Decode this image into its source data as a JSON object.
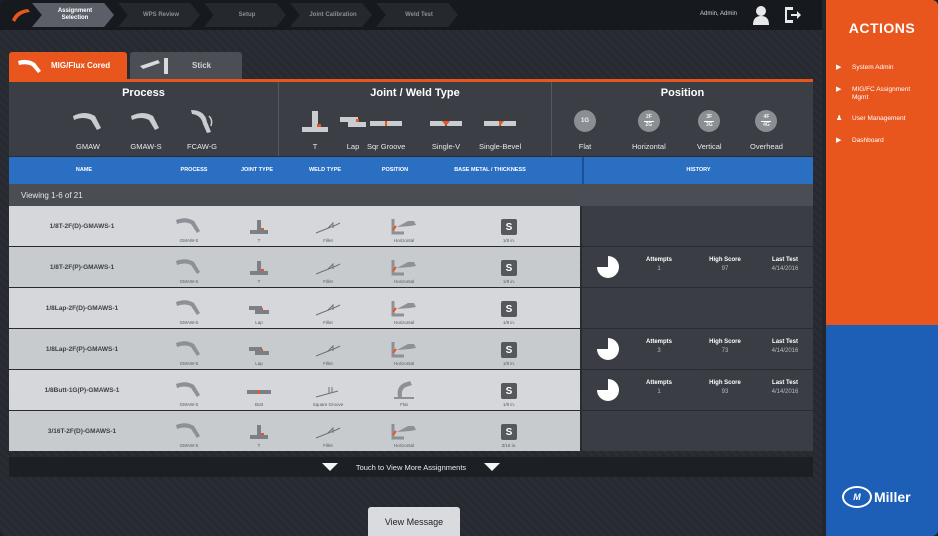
{
  "breadcrumb": [
    {
      "label": "Assignment Selection",
      "active": true
    },
    {
      "label": "WPS Review",
      "active": false
    },
    {
      "label": "Setup",
      "active": false
    },
    {
      "label": "Joint Calibration",
      "active": false
    },
    {
      "label": "Weld Test",
      "active": false
    }
  ],
  "user": {
    "name": "Admin, Admin"
  },
  "tabs": [
    {
      "label": "MIG/Flux Cored",
      "active": true
    },
    {
      "label": "Stick",
      "active": false
    }
  ],
  "filters": {
    "process": {
      "title": "Process",
      "options": [
        "GMAW",
        "GMAW-S",
        "FCAW-G"
      ]
    },
    "joint": {
      "title": "Joint / Weld Type",
      "options": [
        "T",
        "Lap",
        "Sqr Groove",
        "Single-V",
        "Single-Bevel"
      ]
    },
    "position": {
      "title": "Position",
      "options": [
        {
          "label": "Flat",
          "code": "1G"
        },
        {
          "label": "Horizontal",
          "code_top": "2F",
          "code_bottom": "2G"
        },
        {
          "label": "Vertical",
          "code_top": "3F",
          "code_bottom": "3G"
        },
        {
          "label": "Overhead",
          "code_top": "4F",
          "code_bottom": "4G"
        }
      ]
    }
  },
  "table": {
    "headers": {
      "name": "NAME",
      "process": "PROCESS",
      "joint_type": "JOINT TYPE",
      "weld_type": "WELD TYPE",
      "position": "POSITION",
      "base_metal": "BASE METAL / THICKNESS",
      "history": "HISTORY"
    },
    "viewing": "Viewing 1-6 of 21",
    "history_labels": {
      "attempts": "Attempts",
      "high_score": "High Score",
      "last_test": "Last Test"
    },
    "rows": [
      {
        "name": "1/8T-2F(D)-GMAWS-1",
        "process": "GMAW-S",
        "joint": "T",
        "weld": "Fillet",
        "position": "Horizontal",
        "metal": "S",
        "thickness": "1/8 in.",
        "history": null
      },
      {
        "name": "1/8T-2F(P)-GMAWS-1",
        "process": "GMAW-S",
        "joint": "T",
        "weld": "Fillet",
        "position": "Horizontal",
        "metal": "S",
        "thickness": "1/8 in.",
        "history": {
          "attempts": "1",
          "high_score": "97",
          "last_test": "4/14/2016"
        }
      },
      {
        "name": "1/8Lap-2F(D)-GMAWS-1",
        "process": "GMAW-S",
        "joint": "Lap",
        "weld": "Fillet",
        "position": "Horizontal",
        "metal": "S",
        "thickness": "1/8 in.",
        "history": null
      },
      {
        "name": "1/8Lap-2F(P)-GMAWS-1",
        "process": "GMAW-S",
        "joint": "Lap",
        "weld": "Fillet",
        "position": "Horizontal",
        "metal": "S",
        "thickness": "1/8 in.",
        "history": {
          "attempts": "3",
          "high_score": "73",
          "last_test": "4/14/2016"
        }
      },
      {
        "name": "1/8Butt-1G(P)-GMAWS-1",
        "process": "GMAW-S",
        "joint": "Butt",
        "weld": "Square Groove",
        "position": "Flat",
        "metal": "S",
        "thickness": "1/8 in.",
        "history": {
          "attempts": "1",
          "high_score": "93",
          "last_test": "4/14/2016"
        }
      },
      {
        "name": "3/16T-2F(D)-GMAWS-1",
        "process": "GMAW-S",
        "joint": "T",
        "weld": "Fillet",
        "position": "Horizontal",
        "metal": "S",
        "thickness": "3/16 in.",
        "history": null
      }
    ]
  },
  "more_label": "Touch to View More Assignments",
  "view_message_label": "View Message",
  "actions": {
    "title": "ACTIONS",
    "items": [
      {
        "label": "System Admin",
        "icon": "play-icon"
      },
      {
        "label": "MIG/FC Assignment Mgmt",
        "icon": "play-icon"
      },
      {
        "label": "User Management",
        "icon": "user-icon"
      },
      {
        "label": "Dashboard",
        "icon": "play-icon"
      }
    ]
  },
  "brand": {
    "name": "Miller",
    "mark": "M"
  },
  "colors": {
    "accent_orange": "#e8561e",
    "header_blue": "#2b6fc3",
    "sidebar_blue": "#1d5fb6"
  }
}
